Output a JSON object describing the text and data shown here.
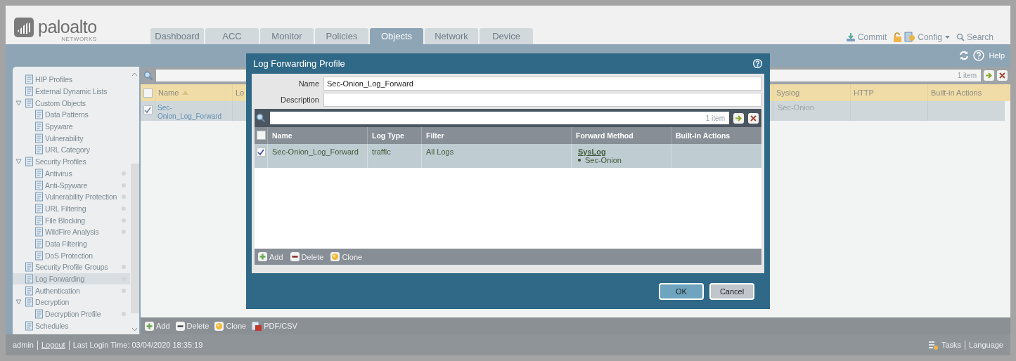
{
  "header": {
    "logo": {
      "brand": "paloalto",
      "sub": "NETWORKS"
    },
    "tabs": [
      {
        "label": "Dashboard",
        "selected": false
      },
      {
        "label": "ACC",
        "selected": false
      },
      {
        "label": "Monitor",
        "selected": false
      },
      {
        "label": "Policies",
        "selected": false
      },
      {
        "label": "Objects",
        "selected": true
      },
      {
        "label": "Network",
        "selected": false
      },
      {
        "label": "Device",
        "selected": false
      }
    ],
    "commit": "Commit",
    "config": "Config",
    "search": "Search",
    "help": "Help"
  },
  "sidebar": {
    "items": [
      {
        "label": "HIP Profiles",
        "selected": false,
        "dot": false
      },
      {
        "label": "External Dynamic Lists",
        "selected": false,
        "dot": false
      },
      {
        "label": "Custom Objects",
        "selected": false,
        "dot": false,
        "expanded": true,
        "children": [
          {
            "label": "Data Patterns",
            "selected": false,
            "dot": false
          },
          {
            "label": "Spyware",
            "selected": false,
            "dot": false
          },
          {
            "label": "Vulnerability",
            "selected": false,
            "dot": false
          },
          {
            "label": "URL Category",
            "selected": false,
            "dot": false
          }
        ]
      },
      {
        "label": "Security Profiles",
        "selected": false,
        "dot": false,
        "expanded": true,
        "children": [
          {
            "label": "Antivirus",
            "selected": false,
            "dot": true
          },
          {
            "label": "Anti-Spyware",
            "selected": false,
            "dot": true
          },
          {
            "label": "Vulnerability Protection",
            "selected": false,
            "dot": true
          },
          {
            "label": "URL Filtering",
            "selected": false,
            "dot": true
          },
          {
            "label": "File Blocking",
            "selected": false,
            "dot": true
          },
          {
            "label": "WildFire Analysis",
            "selected": false,
            "dot": true
          },
          {
            "label": "Data Filtering",
            "selected": false,
            "dot": false
          },
          {
            "label": "DoS Protection",
            "selected": false,
            "dot": false
          }
        ]
      },
      {
        "label": "Security Profile Groups",
        "selected": false,
        "dot": true
      },
      {
        "label": "Log Forwarding",
        "selected": true,
        "dot": true
      },
      {
        "label": "Authentication",
        "selected": false,
        "dot": true
      },
      {
        "label": "Decryption",
        "selected": false,
        "dot": false,
        "expanded": true,
        "children": [
          {
            "label": "Decryption Profile",
            "selected": false,
            "dot": true
          }
        ]
      },
      {
        "label": "Schedules",
        "selected": false,
        "dot": false
      }
    ]
  },
  "main": {
    "count": "1 item",
    "all_checked": false,
    "name_sorted": true,
    "columns": [
      "Name",
      "Lo",
      "Syslog",
      "HTTP",
      "Built-in Actions"
    ],
    "rows": [
      {
        "checked": true,
        "name": "Sec-Onion_Log_Forward",
        "syslog": "Sec-Onion"
      }
    ],
    "actions": [
      {
        "label": "Add",
        "kind": "add"
      },
      {
        "label": "Delete",
        "kind": "delete"
      },
      {
        "label": "Clone",
        "kind": "clone"
      },
      {
        "label": "PDF/CSV",
        "kind": "pdf"
      }
    ]
  },
  "dialog": {
    "title": "Log Forwarding Profile",
    "fields": [
      {
        "label": "Name",
        "value": "Sec-Onion_Log_Forward"
      },
      {
        "label": "Description"
      }
    ],
    "count": "1 item",
    "all_checked": false,
    "columns": [
      "Name",
      "Log Type",
      "Filter",
      "Forward Method",
      "Built-in Actions"
    ],
    "rows": [
      {
        "checked": true,
        "name": "Sec-Onion_Log_Forward",
        "log_type": "traffic",
        "filter": "All Logs",
        "method": "SysLog",
        "targets": [
          "Sec-Onion"
        ]
      }
    ],
    "actions": [
      {
        "label": "Add",
        "kind": "add"
      },
      {
        "label": "Delete",
        "kind": "delete"
      },
      {
        "label": "Clone",
        "kind": "clone"
      }
    ],
    "buttons": [
      {
        "label": "OK",
        "kind": "primary"
      },
      {
        "label": "Cancel",
        "kind": "secondary"
      }
    ]
  },
  "footer": {
    "user": "admin",
    "logout": "Logout",
    "last_login": "Last Login Time: 03/04/2020 18:35:19",
    "tasks": "Tasks",
    "language": "Language"
  }
}
